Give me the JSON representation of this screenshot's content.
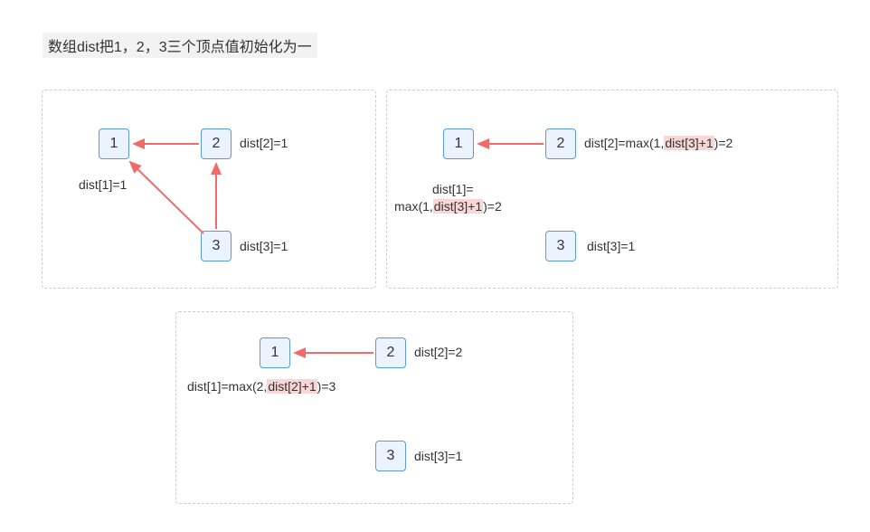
{
  "title": "数组dist把1，2，3三个顶点值初始化为一",
  "panels": {
    "p1": {
      "n1": "1",
      "n2": "2",
      "n3": "3",
      "d1": "dist[1]=1",
      "d2": "dist[2]=1",
      "d3": "dist[3]=1"
    },
    "p2": {
      "n1": "1",
      "n2": "2",
      "n3": "3",
      "d1a": "dist[1]=",
      "d1b_pre": "max(1,",
      "d1b_hl": "dist[3]+1",
      "d1b_post": ")=2",
      "d2_pre": "dist[2]=max(1,",
      "d2_hl": "dist[3]+1",
      "d2_post": ")=2",
      "d3": "dist[3]=1"
    },
    "p3": {
      "n1": "1",
      "n2": "2",
      "n3": "3",
      "d1_pre": "dist[1]=max(2,",
      "d1_hl": "dist[2]+1",
      "d1_post": ")=3",
      "d2": "dist[2]=2",
      "d3": "dist[3]=1"
    }
  },
  "chart_data": [
    {
      "type": "graph-step",
      "step": 1,
      "nodes": [
        1,
        2,
        3
      ],
      "edges": [
        [
          2,
          1
        ],
        [
          3,
          1
        ],
        [
          3,
          2
        ]
      ],
      "dist": {
        "1": 1,
        "2": 1,
        "3": 1
      },
      "note": "init"
    },
    {
      "type": "graph-step",
      "step": 2,
      "nodes": [
        1,
        2,
        3
      ],
      "edges": [
        [
          2,
          1
        ]
      ],
      "dist": {
        "1": "max(1,dist[3]+1)=2",
        "2": "max(1,dist[3]+1)=2",
        "3": 1
      },
      "highlight": "dist[3]+1"
    },
    {
      "type": "graph-step",
      "step": 3,
      "nodes": [
        1,
        2,
        3
      ],
      "edges": [
        [
          2,
          1
        ]
      ],
      "dist": {
        "1": "max(2,dist[2]+1)=3",
        "2": 2,
        "3": 1
      },
      "highlight": "dist[2]+1"
    }
  ]
}
